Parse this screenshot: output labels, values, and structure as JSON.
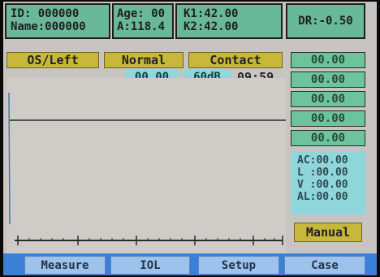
{
  "patient": {
    "id_line": "ID:  000000",
    "name_line": "Name:000000",
    "age_line": "Age: 00",
    "a_line": "A:118.4",
    "k1_line": "K1:42.00",
    "k2_line": "K2:42.00",
    "dr_line": "DR:-0.50"
  },
  "mode": {
    "eye": "OS/Left",
    "lens": "Normal",
    "contact": "Contact"
  },
  "status": {
    "value": "00.00",
    "gain": "60dB",
    "time": "09:59"
  },
  "measurements": [
    "00.00",
    "00.00",
    "00.00",
    "00.00",
    "00.00"
  ],
  "stats": {
    "ac": "AC:00.00",
    "l": "L :00.00",
    "v": "V :00.00",
    "al": "AL:00.00"
  },
  "manual_label": "Manual",
  "tabs": [
    "Measure",
    "IOL",
    "Setup",
    "Case"
  ],
  "colors": {
    "panel_green": "#6ab89a",
    "yellow": "#c7b73a",
    "cyan": "#8ed8dd",
    "tab_blue": "#9dc2ec",
    "bar_blue": "#3c7fd6"
  }
}
